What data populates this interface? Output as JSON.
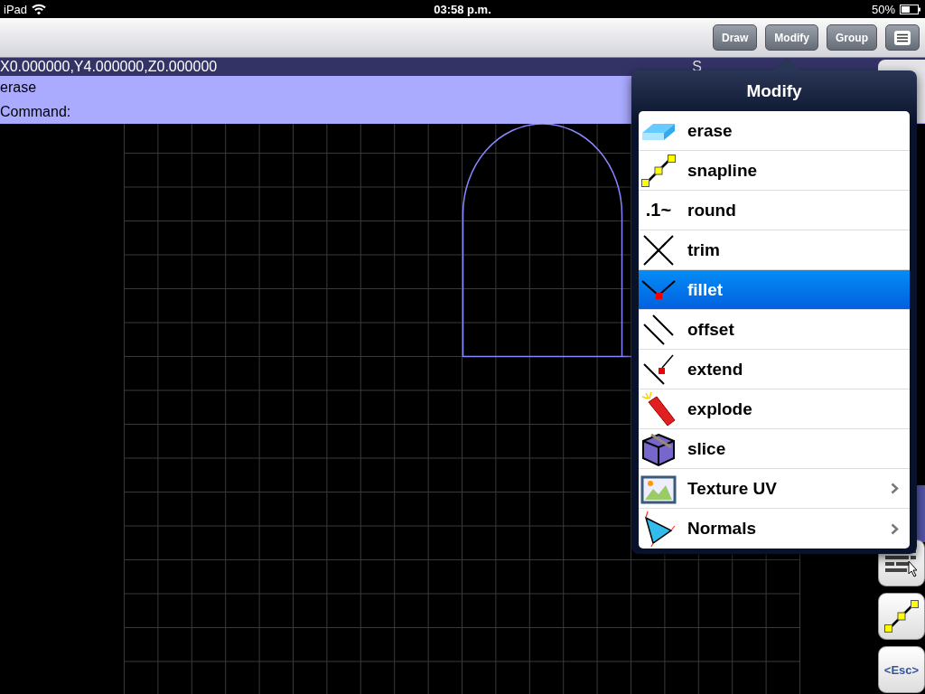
{
  "status_bar": {
    "device": "iPad",
    "time": "03:58 p.m.",
    "battery": "50%"
  },
  "toolbar": {
    "buttons": [
      "Draw",
      "Modify",
      "Group"
    ]
  },
  "coordinates": "X0.000000,Y4.000000,Z0.000000",
  "coord_tail": "S",
  "last_command": "erase",
  "prompt": "Command:",
  "side_buttons": [
    {
      "kind": "table-cursor"
    },
    {
      "kind": "snapline"
    },
    {
      "kind": "text",
      "label": "<Esc>"
    }
  ],
  "popover": {
    "title": "Modify",
    "items": [
      {
        "label": "erase",
        "kind": "erase",
        "selected": false,
        "submenu": false
      },
      {
        "label": "snapline",
        "kind": "snapline",
        "selected": false,
        "submenu": false
      },
      {
        "label": "round",
        "kind": "glyph",
        "glyph": ".1~",
        "selected": false,
        "submenu": false
      },
      {
        "label": "trim",
        "kind": "trim",
        "selected": false,
        "submenu": false
      },
      {
        "label": "fillet",
        "kind": "fillet",
        "selected": true,
        "submenu": false
      },
      {
        "label": "offset",
        "kind": "offset",
        "selected": false,
        "submenu": false
      },
      {
        "label": "extend",
        "kind": "extend",
        "selected": false,
        "submenu": false
      },
      {
        "label": "explode",
        "kind": "explode",
        "selected": false,
        "submenu": false
      },
      {
        "label": "slice",
        "kind": "slice",
        "selected": false,
        "submenu": false
      },
      {
        "label": "Texture UV",
        "kind": "picture",
        "selected": false,
        "submenu": true
      },
      {
        "label": "Normals",
        "kind": "triangle",
        "selected": false,
        "submenu": true
      }
    ]
  }
}
